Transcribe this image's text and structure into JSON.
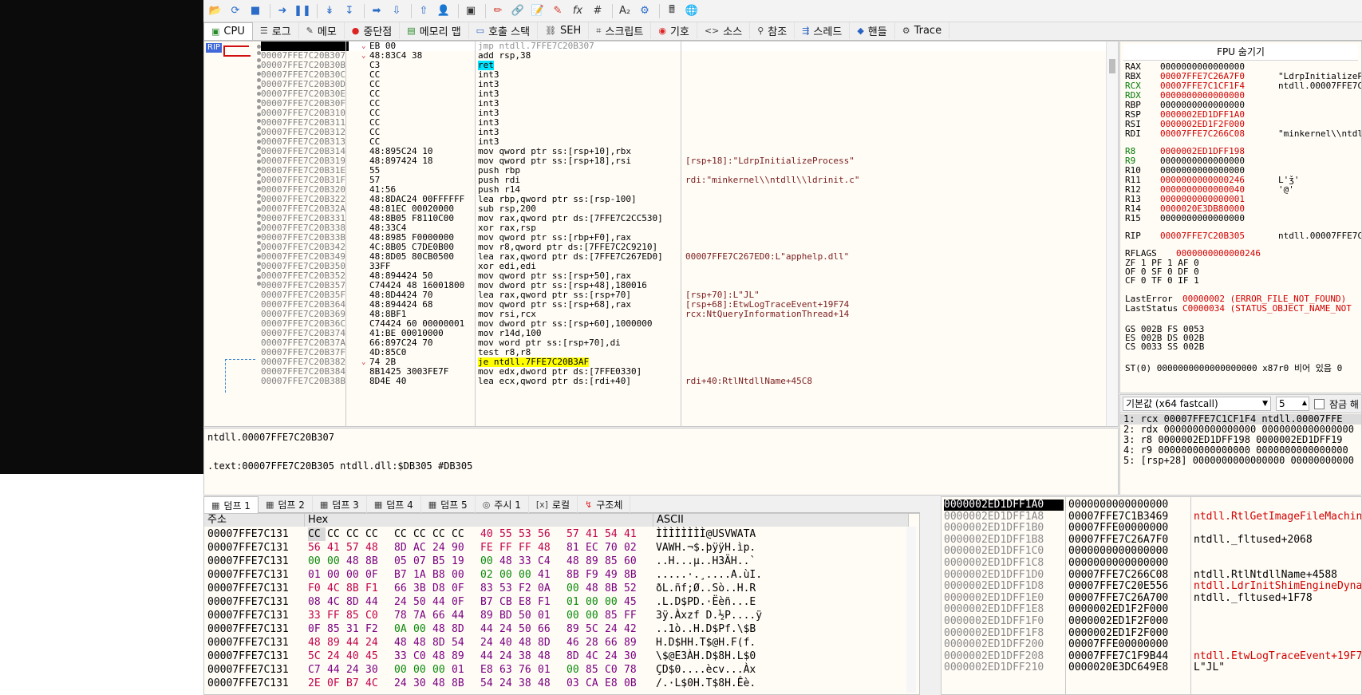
{
  "toolbar_icons": [
    "open-icon",
    "restart-icon",
    "stop-icon",
    "run-icon",
    "pause-icon",
    "step-into-icon",
    "step-over-icon",
    "trace-into-icon",
    "trace-over-icon",
    "execute-till-return-icon",
    "run-to-user-code-icon",
    "memory-icon",
    "hardware-breakpoint-icon",
    "patch-icon",
    "script-icon",
    "comment-icon",
    "function-icon",
    "hash-icon",
    "font-icon",
    "preferences-icon",
    "calculator-icon",
    "help-icon"
  ],
  "toolbar_glyphs": {
    "fx": "fx",
    "hash": "#",
    "font": "A₂"
  },
  "tabs": [
    {
      "label": "CPU",
      "icon": "cpu-icon"
    },
    {
      "label": "로그",
      "icon": "log-icon"
    },
    {
      "label": "메모",
      "icon": "notes-icon"
    },
    {
      "label": "중단점",
      "icon": "breakpoint-icon"
    },
    {
      "label": "메모리 맵",
      "icon": "memory-map-icon"
    },
    {
      "label": "호출 스택",
      "icon": "call-stack-icon"
    },
    {
      "label": "SEH",
      "icon": "seh-icon"
    },
    {
      "label": "스크립트",
      "icon": "script-icon"
    },
    {
      "label": "기호",
      "icon": "symbols-icon"
    },
    {
      "label": "소스",
      "icon": "source-icon"
    },
    {
      "label": "참조",
      "icon": "references-icon"
    },
    {
      "label": "스레드",
      "icon": "threads-icon"
    },
    {
      "label": "핸들",
      "icon": "handles-icon"
    },
    {
      "label": "Trace",
      "icon": "trace-icon"
    }
  ],
  "rip_label": "RIP",
  "disasm": [
    {
      "addr": "00007FFE7C20B305",
      "bytes": "EB 00",
      "ins": "jmp ntdll.7FFE7C20B307",
      "cmt": "",
      "style": "jmp"
    },
    {
      "addr": "00007FFE7C20B307",
      "bytes": "48:83C4 38",
      "ins": "add rsp,38",
      "cmt": ""
    },
    {
      "addr": "00007FFE7C20B30B",
      "bytes": "C3",
      "ins": "ret",
      "cmt": "",
      "style": "ret"
    },
    {
      "addr": "00007FFE7C20B30C",
      "bytes": "CC",
      "ins": "int3",
      "cmt": ""
    },
    {
      "addr": "00007FFE7C20B30D",
      "bytes": "CC",
      "ins": "int3",
      "cmt": ""
    },
    {
      "addr": "00007FFE7C20B30E",
      "bytes": "CC",
      "ins": "int3",
      "cmt": ""
    },
    {
      "addr": "00007FFE7C20B30F",
      "bytes": "CC",
      "ins": "int3",
      "cmt": ""
    },
    {
      "addr": "00007FFE7C20B310",
      "bytes": "CC",
      "ins": "int3",
      "cmt": ""
    },
    {
      "addr": "00007FFE7C20B311",
      "bytes": "CC",
      "ins": "int3",
      "cmt": ""
    },
    {
      "addr": "00007FFE7C20B312",
      "bytes": "CC",
      "ins": "int3",
      "cmt": ""
    },
    {
      "addr": "00007FFE7C20B313",
      "bytes": "CC",
      "ins": "int3",
      "cmt": ""
    },
    {
      "addr": "00007FFE7C20B314",
      "bytes": "48:895C24 10",
      "ins": "mov qword ptr ss:[rsp+10],rbx",
      "cmt": ""
    },
    {
      "addr": "00007FFE7C20B319",
      "bytes": "48:897424 18",
      "ins": "mov qword ptr ss:[rsp+18],rsi",
      "cmt": "[rsp+18]:\"LdrpInitializeProcess\""
    },
    {
      "addr": "00007FFE7C20B31E",
      "bytes": "55",
      "ins": "push rbp",
      "cmt": ""
    },
    {
      "addr": "00007FFE7C20B31F",
      "bytes": "57",
      "ins": "push rdi",
      "cmt": "rdi:\"minkernel\\\\ntdll\\\\ldrinit.c\""
    },
    {
      "addr": "00007FFE7C20B320",
      "bytes": "41:56",
      "ins": "push r14",
      "cmt": ""
    },
    {
      "addr": "00007FFE7C20B322",
      "bytes": "48:8DAC24 00FFFFFF",
      "ins": "lea rbp,qword ptr ss:[rsp-100]",
      "cmt": ""
    },
    {
      "addr": "00007FFE7C20B32A",
      "bytes": "48:81EC 00020000",
      "ins": "sub rsp,200",
      "cmt": ""
    },
    {
      "addr": "00007FFE7C20B331",
      "bytes": "48:8B05 F8110C00",
      "ins": "mov rax,qword ptr ds:[7FFE7C2CC530]",
      "cmt": "",
      "style": "mem"
    },
    {
      "addr": "00007FFE7C20B338",
      "bytes": "48:33C4",
      "ins": "xor rax,rsp",
      "cmt": ""
    },
    {
      "addr": "00007FFE7C20B33B",
      "bytes": "48:8985 F0000000",
      "ins": "mov qword ptr ss:[rbp+F0],rax",
      "cmt": ""
    },
    {
      "addr": "00007FFE7C20B342",
      "bytes": "4C:8B05 C7DE0B00",
      "ins": "mov r8,qword ptr ds:[7FFE7C2C9210]",
      "cmt": "",
      "style": "mem"
    },
    {
      "addr": "00007FFE7C20B349",
      "bytes": "48:8D05 80CB0500",
      "ins": "lea rax,qword ptr ds:[7FFE7C267ED0]",
      "cmt": "00007FFE7C267ED0:L\"apphelp.dll\"",
      "style": "mem"
    },
    {
      "addr": "00007FFE7C20B350",
      "bytes": "33FF",
      "ins": "xor edi,edi",
      "cmt": ""
    },
    {
      "addr": "00007FFE7C20B352",
      "bytes": "48:894424 50",
      "ins": "mov qword ptr ss:[rsp+50],rax",
      "cmt": ""
    },
    {
      "addr": "00007FFE7C20B357",
      "bytes": "C74424 48 16001800",
      "ins": "mov dword ptr ss:[rsp+48],180016",
      "cmt": ""
    },
    {
      "addr": "00007FFE7C20B35F",
      "bytes": "48:8D4424 70",
      "ins": "lea rax,qword ptr ss:[rsp+70]",
      "cmt": "[rsp+70]:L\"JL\""
    },
    {
      "addr": "00007FFE7C20B364",
      "bytes": "48:894424 68",
      "ins": "mov qword ptr ss:[rsp+68],rax",
      "cmt": "[rsp+68]:EtwLogTraceEvent+19F74"
    },
    {
      "addr": "00007FFE7C20B369",
      "bytes": "48:8BF1",
      "ins": "mov rsi,rcx",
      "cmt": "rcx:NtQueryInformationThread+14"
    },
    {
      "addr": "00007FFE7C20B36C",
      "bytes": "C74424 60 00000001",
      "ins": "mov dword ptr ss:[rsp+60],1000000",
      "cmt": ""
    },
    {
      "addr": "00007FFE7C20B374",
      "bytes": "41:BE 00010000",
      "ins": "mov r14d,100",
      "cmt": ""
    },
    {
      "addr": "00007FFE7C20B37A",
      "bytes": "66:897C24 70",
      "ins": "mov word ptr ss:[rsp+70],di",
      "cmt": ""
    },
    {
      "addr": "00007FFE7C20B37F",
      "bytes": "4D:85C0",
      "ins": "test r8,r8",
      "cmt": ""
    },
    {
      "addr": "00007FFE7C20B382",
      "bytes": "74 2B",
      "ins": "je ntdll.7FFE7C20B3AF",
      "cmt": "",
      "style": "je"
    },
    {
      "addr": "00007FFE7C20B384",
      "bytes": "8B1425 3003FE7F",
      "ins": "mov edx,dword ptr ds:[7FFE0330]",
      "cmt": "",
      "style": "mem"
    },
    {
      "addr": "00007FFE7C20B38B",
      "bytes": "8D4E 40",
      "ins": "lea ecx,qword ptr ds:[rdi+40]",
      "cmt": "rdi+40:RtlNtdllName+45C8"
    }
  ],
  "info": {
    "line1": "ntdll.00007FFE7C20B307",
    "line2": ".text:00007FFE7C20B305 ntdll.dll:$DB305 #DB305"
  },
  "fpu_toggle": "FPU 숨기기",
  "registers": [
    {
      "name": "RAX",
      "value": "0000000000000000",
      "cmt": "",
      "nc": "",
      "vc": ""
    },
    {
      "name": "RBX",
      "value": "00007FFE7C26A7F0",
      "cmt": "\"LdrpInitializeP",
      "nc": "",
      "vc": "red"
    },
    {
      "name": "RCX",
      "value": "00007FFE7C1CF1F4",
      "cmt": "ntdll.00007FFE7C",
      "nc": "green",
      "vc": "red"
    },
    {
      "name": "RDX",
      "value": "0000000000000000",
      "cmt": "",
      "nc": "green",
      "vc": "red"
    },
    {
      "name": "RBP",
      "value": "0000000000000000",
      "cmt": "",
      "nc": "",
      "vc": ""
    },
    {
      "name": "RSP",
      "value": "0000002ED1DFF1A0",
      "cmt": "",
      "nc": "",
      "vc": "red"
    },
    {
      "name": "RSI",
      "value": "0000002ED1F2F000",
      "cmt": "",
      "nc": "",
      "vc": "red"
    },
    {
      "name": "RDI",
      "value": "00007FFE7C266C08",
      "cmt": "\"minkernel\\\\ntdll",
      "nc": "",
      "vc": "red"
    },
    {
      "name": "R8",
      "value": "0000002ED1DFF198",
      "cmt": "",
      "nc": "green",
      "vc": "red"
    },
    {
      "name": "R9",
      "value": "0000000000000000",
      "cmt": "",
      "nc": "green",
      "vc": ""
    },
    {
      "name": "R10",
      "value": "0000000000000000",
      "cmt": "",
      "nc": "",
      "vc": ""
    },
    {
      "name": "R11",
      "value": "0000000000000246",
      "cmt": "L'ǯ'",
      "nc": "",
      "vc": "red"
    },
    {
      "name": "R12",
      "value": "0000000000000040",
      "cmt": "'@'",
      "nc": "",
      "vc": "red"
    },
    {
      "name": "R13",
      "value": "0000000000000001",
      "cmt": "",
      "nc": "",
      "vc": "red"
    },
    {
      "name": "R14",
      "value": "0000020E3DB80000",
      "cmt": "",
      "nc": "",
      "vc": "red"
    },
    {
      "name": "R15",
      "value": "0000000000000000",
      "cmt": "",
      "nc": "",
      "vc": ""
    },
    {
      "name": "RIP",
      "value": "00007FFE7C20B305",
      "cmt": "ntdll.00007FFE7C",
      "nc": "",
      "vc": "red"
    }
  ],
  "rflags": {
    "name": "RFLAGS",
    "value": "0000000000000246"
  },
  "flags": [
    "ZF 1  PF 1  AF 0",
    "OF 0  SF 0  DF 0",
    "CF 0  TF 0  IF 1"
  ],
  "last_error": {
    "name": "LastError",
    "value": "00000002 (ERROR_FILE_NOT_FOUND)"
  },
  "last_status": {
    "name": "LastStatus",
    "value": "C0000034 (STATUS_OBJECT_NAME_NOT"
  },
  "segments": [
    "GS 002B  FS 0053",
    "ES 002B  DS 002B",
    "CS 0033  SS 002B"
  ],
  "st0": "ST(0) 0000000000000000000 x87r0 비어 있음 0",
  "callconv": {
    "select": "기본값 (x64 fastcall)",
    "count": "5",
    "lock_label": "잠금 해"
  },
  "callargs": [
    "1: rcx 00007FFE7C1CF1F4 ntdll.00007FFE",
    "2: rdx 0000000000000000 0000000000000000",
    "3: r8 0000002ED1DFF198 0000002ED1DFF19",
    "4: r9 0000000000000000 0000000000000000",
    "5: [rsp+28] 0000000000000000 00000000000"
  ],
  "dumptabs": [
    {
      "label": "덤프 1",
      "icon": "dump-icon"
    },
    {
      "label": "덤프 2",
      "icon": "dump-icon"
    },
    {
      "label": "덤프 3",
      "icon": "dump-icon"
    },
    {
      "label": "덤프 4",
      "icon": "dump-icon"
    },
    {
      "label": "덤프 5",
      "icon": "dump-icon"
    },
    {
      "label": "주시 1",
      "icon": "watch-icon"
    },
    {
      "label": "로컬",
      "icon": "locals-icon"
    },
    {
      "label": "구조체",
      "icon": "struct-icon"
    }
  ],
  "dump_headers": {
    "addr": "주소",
    "hex": "Hex",
    "ascii": "ASCII"
  },
  "dump_rows": [
    {
      "addr": "00007FFE7C131",
      "hex": [
        "CC",
        "CC",
        "CC",
        "CC",
        "CC",
        "CC",
        "CC",
        "CC",
        "40",
        "55",
        "53",
        "56",
        "57",
        "41",
        "54",
        "41"
      ],
      "colors": [
        0,
        0,
        0,
        0,
        0,
        0,
        0,
        0,
        2,
        2,
        2,
        2,
        2,
        2,
        2,
        2
      ],
      "ascii": "ÌÌÌÌÌÌÌÌ@USVWATA"
    },
    {
      "addr": "00007FFE7C131",
      "hex": [
        "56",
        "41",
        "57",
        "48",
        "8D",
        "AC",
        "24",
        "90",
        "FE",
        "FF",
        "FF",
        "48",
        "81",
        "EC",
        "70",
        "02"
      ],
      "colors": [
        2,
        2,
        2,
        2,
        1,
        1,
        1,
        1,
        2,
        2,
        2,
        2,
        1,
        1,
        1,
        1
      ],
      "ascii": "VAWH.¬$.þÿÿH.ìp."
    },
    {
      "addr": "00007FFE7C131",
      "hex": [
        "00",
        "00",
        "48",
        "8B",
        "05",
        "07",
        "B5",
        "19",
        "00",
        "48",
        "33",
        "C4",
        "48",
        "89",
        "85",
        "60"
      ],
      "colors": [
        3,
        3,
        1,
        1,
        1,
        1,
        1,
        1,
        3,
        1,
        1,
        1,
        1,
        1,
        1,
        1
      ],
      "ascii": "..H...µ..H3ÄH..`"
    },
    {
      "addr": "00007FFE7C131",
      "hex": [
        "01",
        "00",
        "00",
        "0F",
        "B7",
        "1A",
        "B8",
        "00",
        "02",
        "00",
        "00",
        "41",
        "8B",
        "F9",
        "49",
        "8B"
      ],
      "colors": [
        1,
        1,
        1,
        1,
        1,
        1,
        1,
        1,
        3,
        3,
        3,
        1,
        1,
        1,
        1,
        1
      ],
      "ascii": ".....·.¸....A.ùI."
    },
    {
      "addr": "00007FFE7C131",
      "hex": [
        "F0",
        "4C",
        "8B",
        "F1",
        "66",
        "3B",
        "D8",
        "0F",
        "83",
        "53",
        "F2",
        "0A",
        "00",
        "48",
        "8B",
        "52"
      ],
      "colors": [
        2,
        2,
        2,
        2,
        1,
        1,
        1,
        1,
        1,
        1,
        1,
        1,
        3,
        1,
        1,
        1
      ],
      "ascii": "ðL.ñf;Ø..Sò..H.R"
    },
    {
      "addr": "00007FFE7C131",
      "hex": [
        "08",
        "4C",
        "8D",
        "44",
        "24",
        "50",
        "44",
        "0F",
        "B7",
        "CB",
        "E8",
        "F1",
        "01",
        "00",
        "00",
        "45"
      ],
      "colors": [
        1,
        1,
        1,
        1,
        1,
        1,
        1,
        1,
        1,
        1,
        1,
        1,
        3,
        3,
        3,
        1
      ],
      "ascii": ".L.D$PD.·Ëèñ...E"
    },
    {
      "addr": "00007FFE7C131",
      "hex": [
        "33",
        "FF",
        "85",
        "C0",
        "78",
        "7A",
        "66",
        "44",
        "89",
        "BD",
        "50",
        "01",
        "00",
        "00",
        "85",
        "FF"
      ],
      "colors": [
        2,
        2,
        2,
        2,
        1,
        1,
        1,
        1,
        1,
        1,
        1,
        1,
        3,
        3,
        1,
        1
      ],
      "ascii": "3ÿ.Àxzf D.½P....ÿ"
    },
    {
      "addr": "00007FFE7C131",
      "hex": [
        "0F",
        "85",
        "31",
        "F2",
        "0A",
        "00",
        "48",
        "8D",
        "44",
        "24",
        "50",
        "66",
        "89",
        "5C",
        "24",
        "42"
      ],
      "colors": [
        1,
        1,
        1,
        1,
        3,
        3,
        1,
        1,
        1,
        1,
        1,
        1,
        1,
        1,
        1,
        1
      ],
      "ascii": "..1ò..H.D$Pf.\\$B"
    },
    {
      "addr": "00007FFE7C131",
      "hex": [
        "48",
        "89",
        "44",
        "24",
        "48",
        "48",
        "8D",
        "54",
        "24",
        "40",
        "48",
        "8D",
        "46",
        "28",
        "66",
        "89"
      ],
      "colors": [
        2,
        2,
        2,
        2,
        1,
        1,
        1,
        1,
        1,
        1,
        1,
        1,
        1,
        1,
        1,
        1
      ],
      "ascii": "H.D$HH.T$@H.F(f."
    },
    {
      "addr": "00007FFE7C131",
      "hex": [
        "5C",
        "24",
        "40",
        "45",
        "33",
        "C0",
        "48",
        "89",
        "44",
        "24",
        "38",
        "48",
        "8D",
        "4C",
        "24",
        "30"
      ],
      "colors": [
        2,
        2,
        2,
        2,
        1,
        1,
        1,
        1,
        1,
        1,
        1,
        1,
        1,
        1,
        1,
        1
      ],
      "ascii": "\\$@E3ÀH.D$8H.L$0"
    },
    {
      "addr": "00007FFE7C131",
      "hex": [
        "C7",
        "44",
        "24",
        "30",
        "00",
        "00",
        "00",
        "01",
        "E8",
        "63",
        "76",
        "01",
        "00",
        "85",
        "C0",
        "78"
      ],
      "colors": [
        1,
        1,
        1,
        1,
        3,
        3,
        3,
        1,
        1,
        1,
        1,
        1,
        3,
        1,
        1,
        1
      ],
      "ascii": "ÇD$0....ècv...Àx"
    },
    {
      "addr": "00007FFE7C131",
      "hex": [
        "2E",
        "0F",
        "B7",
        "4C",
        "24",
        "30",
        "48",
        "8B",
        "54",
        "24",
        "38",
        "48",
        "03",
        "CA",
        "E8",
        "0B"
      ],
      "colors": [
        2,
        2,
        2,
        2,
        1,
        1,
        1,
        1,
        1,
        1,
        1,
        1,
        1,
        1,
        1,
        1
      ],
      "ascii": "/.·L$0H.T$8H.Êè."
    }
  ],
  "stack": [
    {
      "addr": "0000002ED1DFF1A0",
      "val": "0000000000000000",
      "cmt": "",
      "red": false
    },
    {
      "addr": "0000002ED1DFF1A8",
      "val": "00007FFE7C1B3469",
      "cmt": "ntdll.RtlGetImageFileMachin",
      "red": true
    },
    {
      "addr": "0000002ED1DFF1B0",
      "val": "00007FFE00000000",
      "cmt": "",
      "red": false
    },
    {
      "addr": "0000002ED1DFF1B8",
      "val": "00007FFE7C26A7F0",
      "cmt": "ntdll._fltused+2068",
      "red": false
    },
    {
      "addr": "0000002ED1DFF1C0",
      "val": "0000000000000000",
      "cmt": "",
      "red": false
    },
    {
      "addr": "0000002ED1DFF1C8",
      "val": "0000000000000000",
      "cmt": "",
      "red": false
    },
    {
      "addr": "0000002ED1DFF1D0",
      "val": "00007FFE7C266C08",
      "cmt": "ntdll.RtlNtdllName+4588",
      "red": false
    },
    {
      "addr": "0000002ED1DFF1D8",
      "val": "00007FFE7C20E556",
      "cmt": "ntdll.LdrInitShimEngineDyna",
      "red": true
    },
    {
      "addr": "0000002ED1DFF1E0",
      "val": "00007FFE7C26A700",
      "cmt": "ntdll._fltused+1F78",
      "red": false
    },
    {
      "addr": "0000002ED1DFF1E8",
      "val": "0000002ED1F2F000",
      "cmt": "",
      "red": false
    },
    {
      "addr": "0000002ED1DFF1F0",
      "val": "0000002ED1F2F000",
      "cmt": "",
      "red": false
    },
    {
      "addr": "0000002ED1DFF1F8",
      "val": "0000002ED1F2F000",
      "cmt": "",
      "red": false
    },
    {
      "addr": "0000002ED1DFF200",
      "val": "00007FFE00000000",
      "cmt": "",
      "red": false
    },
    {
      "addr": "0000002ED1DFF208",
      "val": "00007FFE7C1F9B44",
      "cmt": "ntdll.EtwLogTraceEvent+19F7",
      "red": true
    },
    {
      "addr": "0000002ED1DFF210",
      "val": "0000020E3DC649E8",
      "cmt": "L\"JL\"",
      "red": false
    }
  ],
  "colors": {
    "accent": "#4068d8",
    "highlight": "#ffff00",
    "ret": "#00e5ff",
    "error": "#d00000",
    "reg_changed": "#007a00"
  }
}
